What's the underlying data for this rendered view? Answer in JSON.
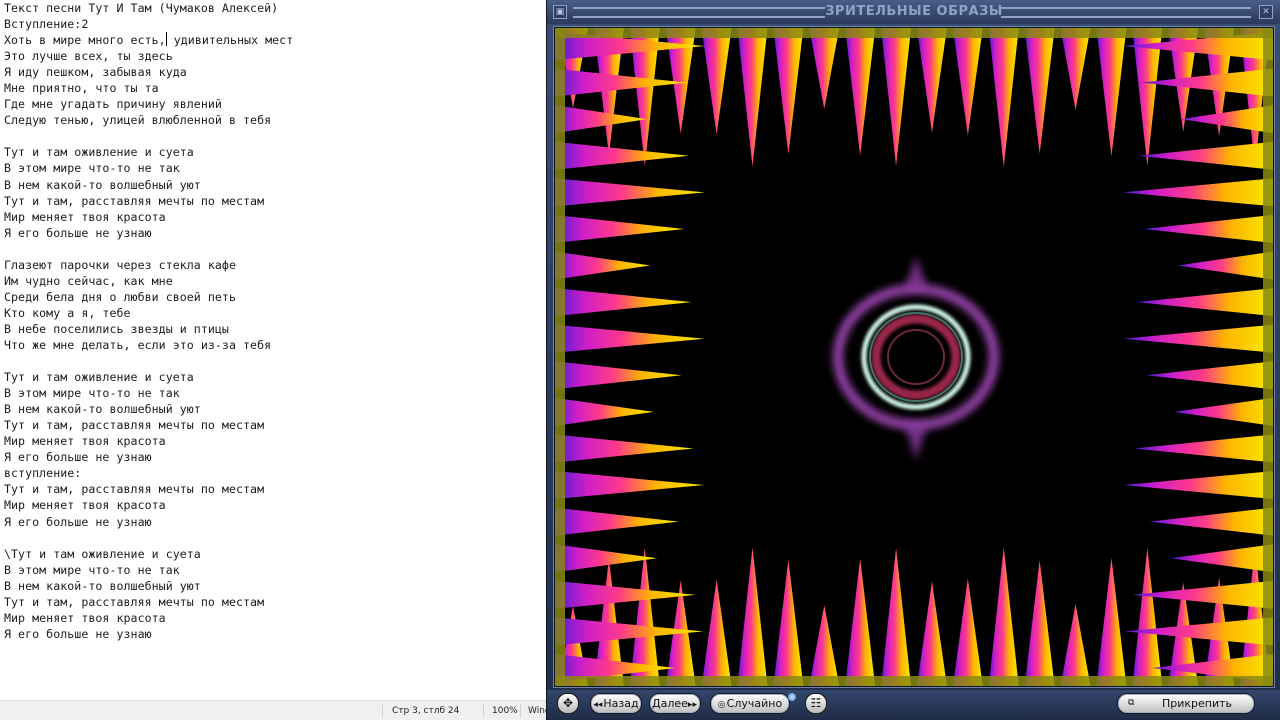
{
  "notepad": {
    "lines": [
      "Текст песни Тут И Там (Чумаков Алексей)",
      "Вступление:2",
      "Хоть в мире много есть, удивительных мест",
      "Это лучше всех, ты здесь",
      "Я иду пешком, забывая куда",
      "Мне приятно, что ты та",
      "Где мне угадать причину явлений",
      "Следую тенью, улицей влюбленной в тебя",
      "",
      "Тут и там оживление и суета",
      "В этом мире что-то не так",
      "В нем какой-то волшебный уют",
      "Тут и там, расставляя мечты по местам",
      "Мир меняет твоя красота",
      "Я его больше не узнаю",
      "",
      "Глазеют парочки через стекла кафе",
      "Им чудно сейчас, как мне",
      "Среди бела дня о любви своей петь",
      "Кто кому а я, тебе",
      "В небе поселились звезды и птицы",
      "Что же мне делать, если это из-за тебя",
      "",
      "Тут и там оживление и суета",
      "В этом мире что-то не так",
      "В нем какой-то волшебный уют",
      "Тут и там, расставляя мечты по местам",
      "Мир меняет твоя красота",
      "Я его больше не узнаю",
      "вступление:",
      "Тут и там, расставляя мечты по местам",
      "Мир меняет твоя красота",
      "Я его больше не узнаю",
      "",
      "\\Тут и там оживление и суета",
      "В этом мире что-то не так",
      "В нем какой-то волшебный уют",
      "Тут и там, расставляя мечты по местам",
      "Мир меняет твоя красота",
      "Я его больше не узнаю"
    ],
    "caret_line": 2,
    "caret_after": "Хоть в мире много есть,",
    "status": {
      "position": "Стр 3, стлб 24",
      "zoom": "100%",
      "encoding_partial": "Wind"
    }
  },
  "visualizer": {
    "title": "ЗРИТЕЛЬНЫЕ ОБРАЗЫ",
    "buttons": {
      "back": "Назад",
      "next": "Далее",
      "random": "Случайно",
      "attach": "Прикрепить"
    },
    "icons": {
      "back": "◂◂",
      "next": "▸▸",
      "random": "◎",
      "attach": "⧉",
      "move": "✥",
      "list": "☷"
    },
    "colors": {
      "window": "#2a3a5e",
      "title": "#8ea2c8",
      "ring_outer": "#c060d0",
      "ring_mid": "#bff5e0",
      "ring_inner": "#a03850",
      "spike_yellow": "#f4e800",
      "spike_magenta": "#e020c0",
      "spike_violet": "#5a28f0"
    }
  }
}
